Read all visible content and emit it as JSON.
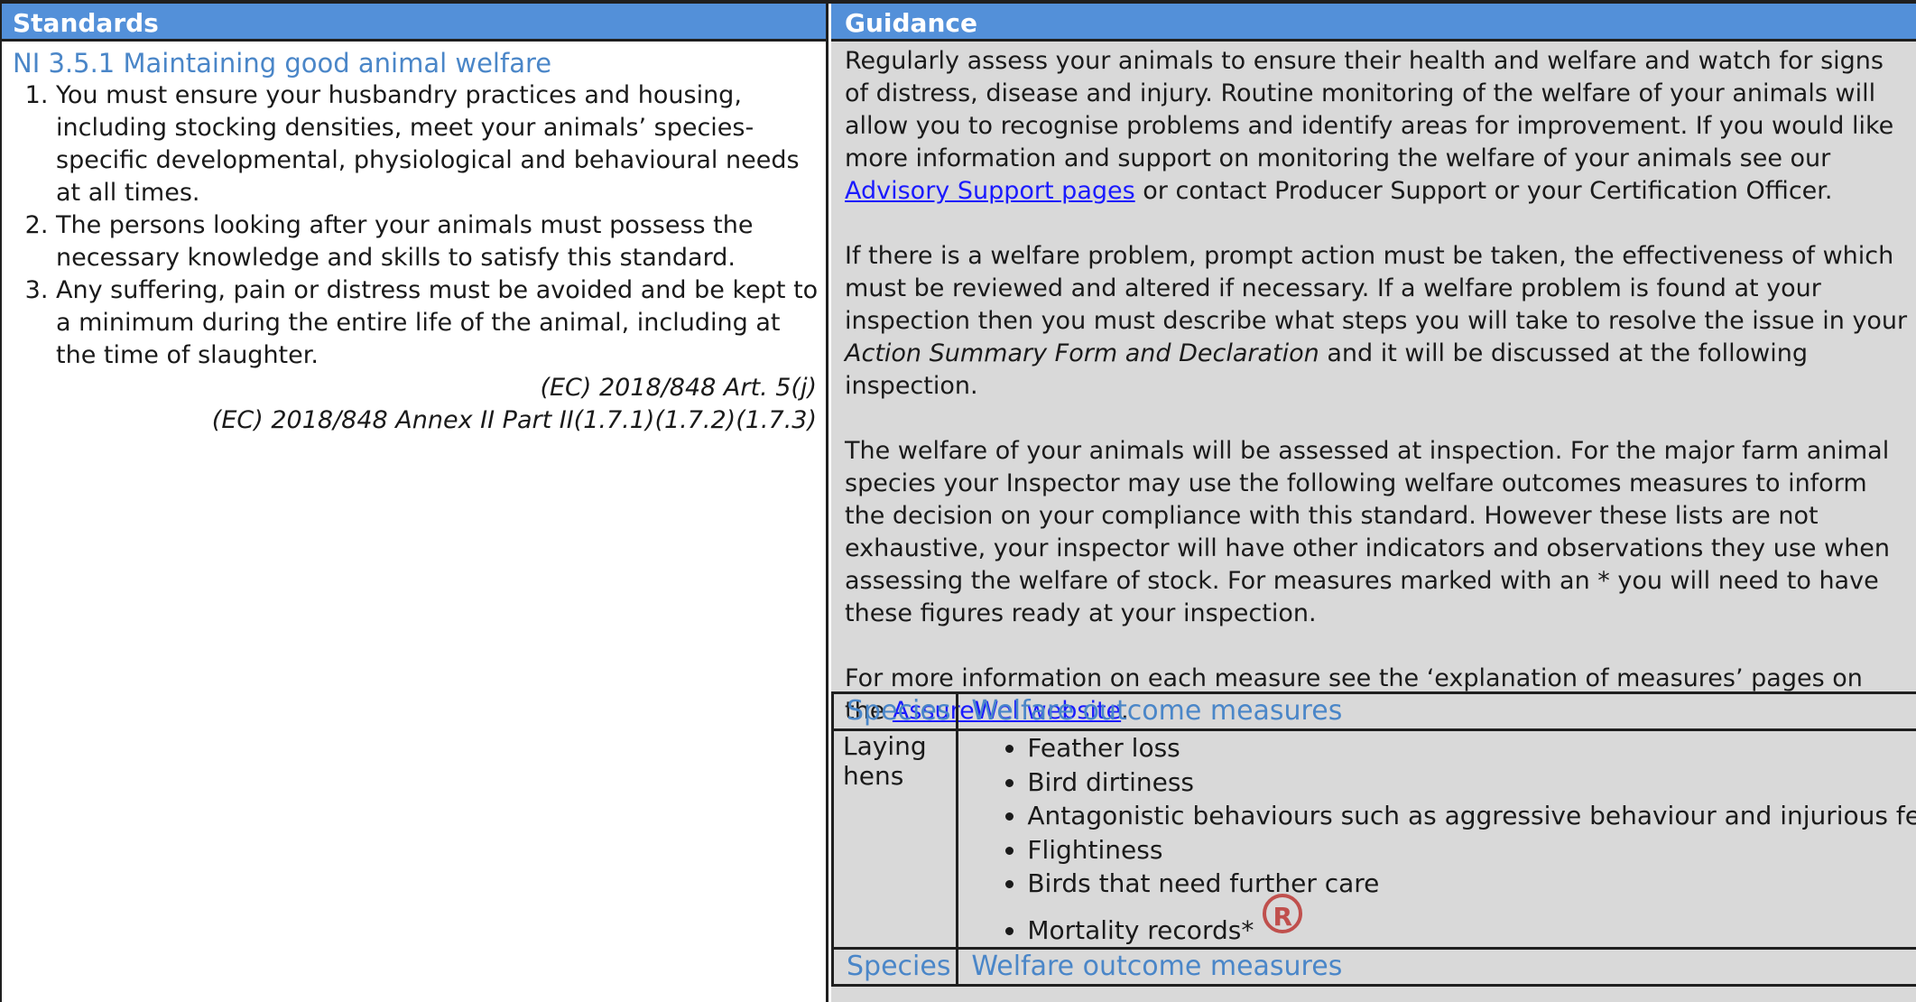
{
  "headers": {
    "standards": "Standards",
    "guidance": "Guidance"
  },
  "standard": {
    "title": "NI 3.5.1 Maintaining good animal welfare",
    "items": [
      "You must ensure your husbandry practices and housing, including stocking densities, meet your animals’ species-specific developmental, physiological and behavioural needs at all times.",
      "The persons looking after your animals must possess the necessary knowledge and skills to satisfy this standard.",
      "Any suffering, pain or distress must be avoided and be kept to a minimum during the entire life of the animal, including at the time of slaughter."
    ],
    "refs": [
      "(EC) 2018/848 Art. 5(j)",
      "(EC) 2018/848 Annex II Part II(1.7.1)(1.7.2)(1.7.3)"
    ]
  },
  "guidance": {
    "p1_text": "Regularly assess your animals to ensure their health and welfare and watch for signs of distress, disease and injury. Routine monitoring of the welfare of your animals will allow you to recognise problems and identify areas for improvement. If you would like more information and support on monitoring the welfare of your animals see our ",
    "p1_link": "Advisory Support pages",
    "p1_after": " or contact Producer Support or your Certification Officer.",
    "p2_text": "If there is a welfare problem, prompt action must be taken, the effectiveness of which must be reviewed and altered if necessary. If a welfare problem is found at your inspection then you must describe what steps you will take to resolve the issue in your ",
    "p2_italic": "Action Summary Form and Declaration",
    "p2_after": " and it will be discussed at the following inspection.",
    "p3": "The welfare of your animals will be assessed at inspection. For the major farm animal species your Inspector may use the following welfare outcomes measures to inform the decision on your compliance with this standard. However these lists are not exhaustive, your inspector will have other indicators and observations they use when assessing the welfare of stock. For measures marked with an * you will need to have these figures ready at your inspection.",
    "p4_text": "For more information on each measure see the ‘explanation of measures’ pages on the ",
    "p4_link": "AssureWel website",
    "p4_after": "."
  },
  "welfare_table": {
    "col_species": "Species",
    "col_measures": "Welfare outcome measures",
    "row_species": "Laying hens",
    "measures": [
      "Feather loss",
      "Bird dirtiness",
      "Antagonistic behaviours such as aggressive behaviour and injurious fe",
      "Flightiness",
      "Birds that need further care",
      "Mortality records*"
    ],
    "badge": "R",
    "col_species_2": "Species",
    "col_measures_2": "Welfare outcome measures"
  }
}
